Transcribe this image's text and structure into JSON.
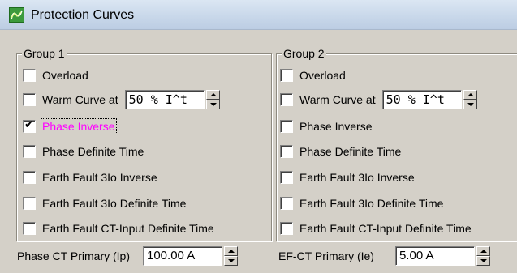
{
  "window": {
    "title": "Protection Curves",
    "icon": "app-curve-icon"
  },
  "groups": [
    {
      "legend": "Group 1",
      "items": [
        {
          "label": "Overload",
          "checked": false
        },
        {
          "label": "Warm Curve at",
          "checked": false,
          "spin_value": "50 % I^t"
        },
        {
          "label": "Phase Inverse",
          "checked": true,
          "highlight_color": "#ff00ff"
        },
        {
          "label": "Phase Definite Time",
          "checked": false
        },
        {
          "label": "Earth Fault 3Io Inverse",
          "checked": false
        },
        {
          "label": "Earth Fault 3Io Definite Time",
          "checked": false
        },
        {
          "label": "Earth Fault CT-Input Definite Time",
          "checked": false
        }
      ]
    },
    {
      "legend": "Group 2",
      "items": [
        {
          "label": "Overload",
          "checked": false
        },
        {
          "label": "Warm Curve at",
          "checked": false,
          "spin_value": "50 % I^t"
        },
        {
          "label": "Phase Inverse",
          "checked": false
        },
        {
          "label": "Phase Definite Time",
          "checked": false
        },
        {
          "label": "Earth Fault 3Io Inverse",
          "checked": false
        },
        {
          "label": "Earth Fault 3Io Definite Time",
          "checked": false
        },
        {
          "label": "Earth Fault CT-Input Definite Time",
          "checked": false
        }
      ]
    }
  ],
  "ct": {
    "phase_label": "Phase CT Primary (Ip)",
    "phase_value": "100.00 A",
    "ef_label": "EF-CT Primary (Ie)",
    "ef_value": "5.00 A"
  }
}
